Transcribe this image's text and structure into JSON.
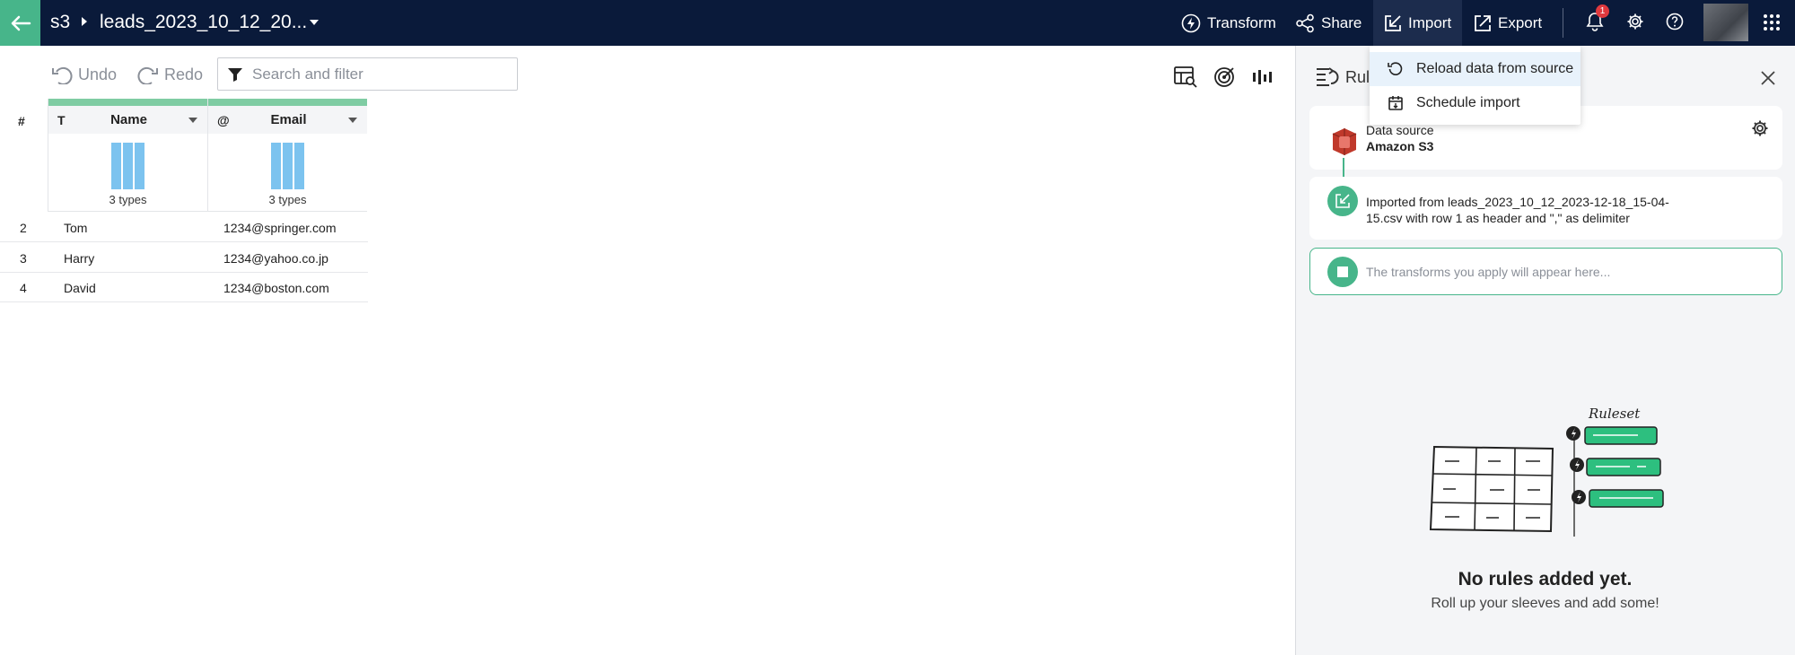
{
  "topbar": {
    "workspace": "s3",
    "title": "leads_2023_10_12_20...",
    "transform_label": "Transform",
    "share_label": "Share",
    "import_label": "Import",
    "export_label": "Export",
    "notification_count": "1",
    "accent_color": "#47b58a",
    "bg_color": "#0a1a3a"
  },
  "toolbar": {
    "undo_label": "Undo",
    "redo_label": "Redo",
    "search_placeholder": "Search and filter"
  },
  "table": {
    "hash_label": "#",
    "columns": [
      {
        "type_indicator": "T",
        "name": "Name",
        "types_label": "3 types"
      },
      {
        "type_indicator": "@",
        "name": "Email",
        "types_label": "3 types"
      }
    ],
    "rows": [
      {
        "num": "2",
        "name": "Tom",
        "email": "1234@springer.com"
      },
      {
        "num": "3",
        "name": "Harry",
        "email": "1234@yahoo.co.jp"
      },
      {
        "num": "4",
        "name": "David",
        "email": "1234@boston.com"
      }
    ]
  },
  "import_menu": {
    "items": [
      {
        "label": "Reload data from source",
        "icon": "reload-icon"
      },
      {
        "label": "Schedule import",
        "icon": "schedule-import-icon"
      }
    ]
  },
  "rules_panel": {
    "header_label": "Rul",
    "data_source_label": "Data source",
    "data_source_name": "Amazon S3",
    "import_text": "Imported from leads_2023_10_12_2023-12-18_15-04-15.csv with row 1 as header and \",\" as delimiter",
    "transforms_placeholder": "The transforms you apply will appear here...",
    "illustration_label": "Ruleset",
    "empty_title": "No rules added yet.",
    "empty_subtitle": "Roll up your sleeves and add some!"
  }
}
